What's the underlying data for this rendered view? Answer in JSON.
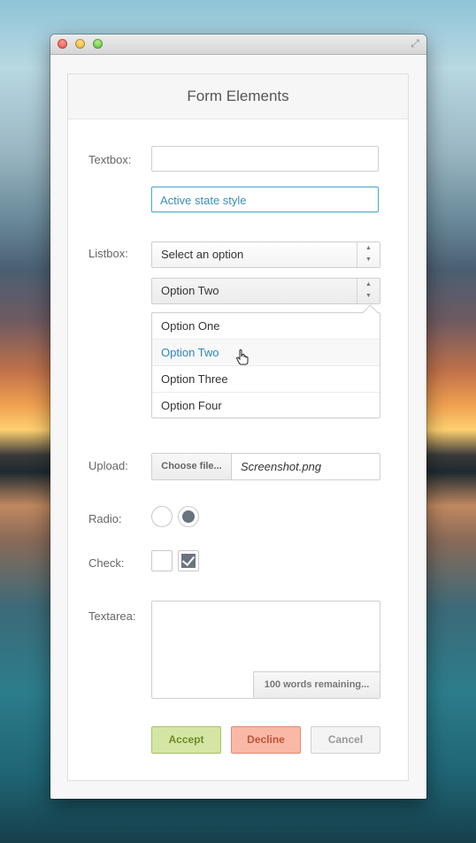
{
  "window": {
    "traffic_lights": [
      "close",
      "minimize",
      "zoom"
    ]
  },
  "form": {
    "title": "Form Elements",
    "textbox_label": "Textbox:",
    "textbox_value": "",
    "textbox_active_value": "Active state style",
    "listbox_label": "Listbox:",
    "listbox1_value": "Select an option",
    "listbox2_value": "Option Two",
    "options": [
      "Option One",
      "Option Two",
      "Option Three",
      "Option Four"
    ],
    "selected_option_index": 1,
    "upload_label": "Upload:",
    "choose_file_label": "Choose file...",
    "file_name": "Screenshot.png",
    "radio_label": "Radio:",
    "radio_selected_index": 1,
    "check_label": "Check:",
    "check_states": [
      false,
      true
    ],
    "textarea_label": "Textarea:",
    "textarea_value": "",
    "words_remaining": "100 words remaining...",
    "buttons": {
      "accept": "Accept",
      "decline": "Decline",
      "cancel": "Cancel"
    },
    "colors": {
      "active": "#3b8fb5",
      "accept_bg": "#d5e6a4",
      "decline_bg": "#f9b9a6",
      "cancel_bg": "#f4f4f4"
    }
  }
}
